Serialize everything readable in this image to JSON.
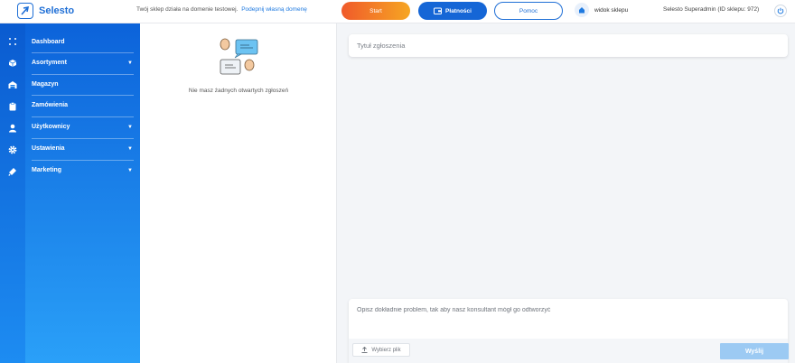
{
  "brand": {
    "name": "Selesto",
    "color": "#1f6fd6"
  },
  "topbar": {
    "domain_note": "Twój sklep działa na domenie testowej.",
    "domain_link": "Podepnij własną domenę",
    "start_label": "Start",
    "payments_label": "Płatności",
    "help_label": "Pomoc",
    "store_view_label": "widok sklepu",
    "admin_label": "Selesto Superadmin (ID sklepu: 972)"
  },
  "colors": {
    "accent": "#1566d6",
    "start_gradient": [
      "#f05a2a",
      "#f6a623"
    ],
    "sidebar": "#0c63da",
    "send_disabled": "#9ccaf3"
  },
  "rail_icons": [
    "grid-icon",
    "box-icon",
    "warehouse-icon",
    "clipboard-icon",
    "user-icon",
    "gear-icon",
    "megaphone-icon"
  ],
  "sidebar": {
    "items": [
      {
        "label": "Dashboard",
        "has_submenu": false
      },
      {
        "label": "Asortyment",
        "has_submenu": true
      },
      {
        "label": "Magazyn",
        "has_submenu": false
      },
      {
        "label": "Zamówienia",
        "has_submenu": false
      },
      {
        "label": "Użytkownicy",
        "has_submenu": true
      },
      {
        "label": "Ustawienia",
        "has_submenu": true
      },
      {
        "label": "Marketing",
        "has_submenu": true
      }
    ],
    "caret": "▼"
  },
  "tickets": {
    "empty_message": "Nie masz żadnych otwartych zgłoszeń"
  },
  "form": {
    "title_placeholder": "Tytuł zgłoszenia",
    "description_placeholder": "Opisz dokładnie problem, tak aby nasz konsultant mógł go odtworzyć",
    "file_button_label": "Wybierz plik",
    "send_label": "Wyślij"
  }
}
